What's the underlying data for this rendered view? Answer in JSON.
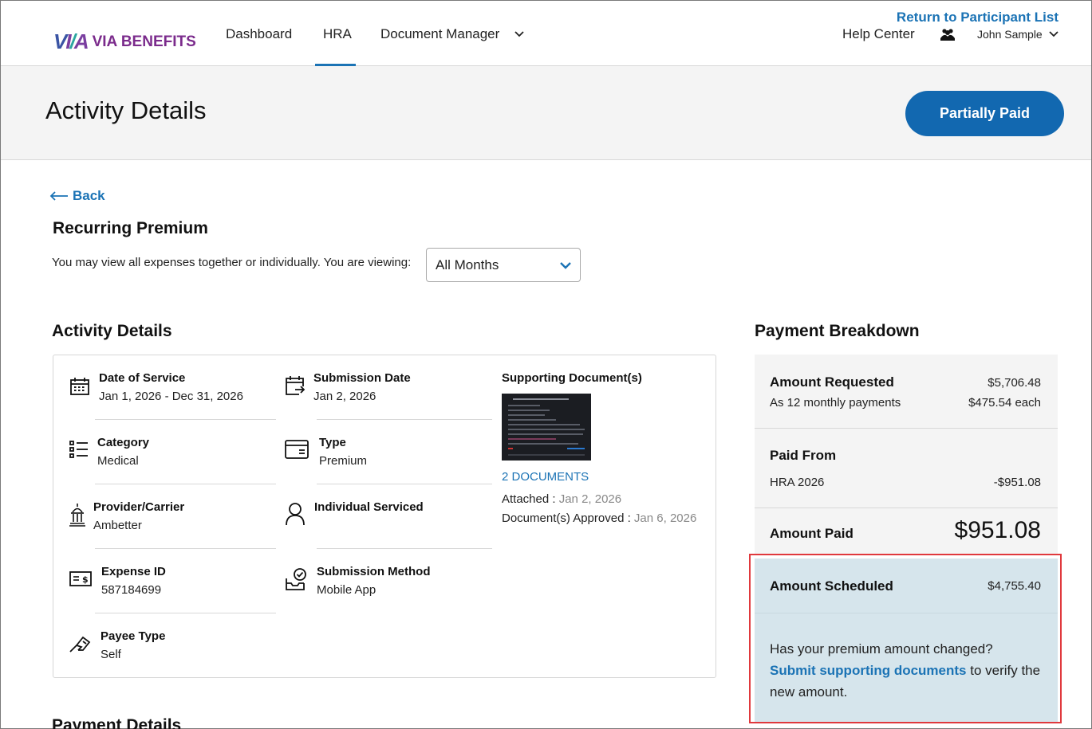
{
  "header": {
    "logo_text": "VIA BENEFITS",
    "nav": [
      "Dashboard",
      "HRA",
      "Document Manager"
    ],
    "active_nav": "HRA",
    "return_link": "Return to Participant List",
    "help_center": "Help Center",
    "user_name": "John Sample"
  },
  "page": {
    "title": "Activity Details",
    "status": "Partially Paid",
    "back_label": "Back",
    "section_title": "Recurring Premium",
    "view_text": "You may view all expenses together or individually. You are viewing:",
    "view_selected": "All Months"
  },
  "activity": {
    "title": "Activity Details",
    "date_of_service": {
      "label": "Date of Service",
      "value": "Jan 1, 2026 - Dec 31, 2026"
    },
    "submission_date": {
      "label": "Submission Date",
      "value": "Jan 2, 2026"
    },
    "category": {
      "label": "Category",
      "value": "Medical"
    },
    "type": {
      "label": "Type",
      "value": "Premium"
    },
    "provider": {
      "label": "Provider/Carrier",
      "value": "Ambetter"
    },
    "individual": {
      "label": "Individual Serviced",
      "value": ""
    },
    "expense_id": {
      "label": "Expense ID",
      "value": "587184699"
    },
    "submission_method": {
      "label": "Submission Method",
      "value": "Mobile App"
    },
    "payee_type": {
      "label": "Payee Type",
      "value": "Self"
    },
    "supporting_docs": {
      "label": "Supporting Document(s)",
      "link": "2 DOCUMENTS",
      "attached_label": "Attached :",
      "attached_value": "Jan 2, 2026",
      "approved_label": "Document(s) Approved :",
      "approved_value": "Jan 6, 2026"
    }
  },
  "payment_breakdown": {
    "title": "Payment Breakdown",
    "amount_requested_label": "Amount Requested",
    "amount_requested_value": "$5,706.48",
    "monthly_label": "As 12 monthly payments",
    "monthly_value": "$475.54 each",
    "paid_from_label": "Paid From",
    "paid_from_account": "HRA 2026",
    "paid_from_value": "-$951.08",
    "amount_paid_label": "Amount Paid",
    "amount_paid_value": "$951.08",
    "amount_scheduled_label": "Amount Scheduled",
    "amount_scheduled_value": "$4,755.40",
    "premium_changed_text": "Has your premium amount changed?",
    "submit_link": "Submit supporting documents",
    "verify_text": " to verify the new amount."
  },
  "payment_details_title": "Payment Details",
  "colors": {
    "accent": "#1b73b5",
    "status_pill": "#1268b0",
    "scheduled_bg": "#d6e5ec",
    "highlight": "#e0393d"
  }
}
